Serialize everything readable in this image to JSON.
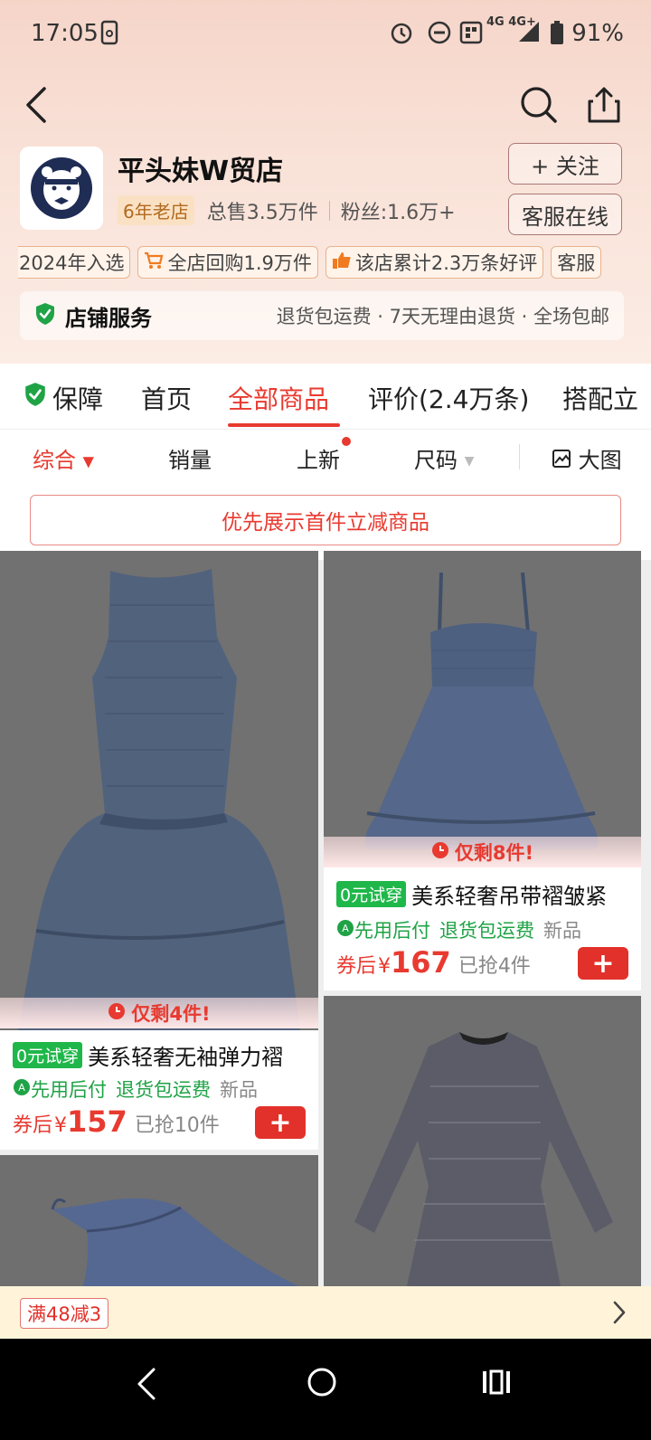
{
  "status_bar": {
    "time": "17:05",
    "network": "4G 4G+",
    "battery": "91%"
  },
  "shop": {
    "name": "平头妹W贸店",
    "years_badge": "6年老店",
    "total_sales": "总售3.5万件",
    "fans": "粉丝:1.6万+",
    "follow_label": "+ 关注",
    "service_label": "客服在线"
  },
  "tags": [
    {
      "text": "2024年入选",
      "icon": ""
    },
    {
      "text": "全店回购1.9万件",
      "icon": "cart-icon"
    },
    {
      "text": "该店累计2.3万条好评",
      "icon": "thumbs-up-icon"
    },
    {
      "text": "客服",
      "icon": ""
    }
  ],
  "shop_service": {
    "title": "店铺服务",
    "items": "退货包运费 · 7天无理由退货 · 全场包邮"
  },
  "tabs": [
    {
      "label": "保障",
      "icon": "shield-check-icon"
    },
    {
      "label": "首页"
    },
    {
      "label": "全部商品",
      "active": true
    },
    {
      "label": "评价(2.4万条)"
    },
    {
      "label": "搭配立"
    }
  ],
  "filters": {
    "comprehensive": "综合",
    "sales": "销量",
    "new": "上新",
    "size": "尺码",
    "large_view": "大图"
  },
  "promo_button": "优先展示首件立减商品",
  "products": [
    {
      "stock_note": "仅剩4件!",
      "trial_badge": "0元试穿",
      "title": "美系轻奢无袖弹力褶",
      "tag_pay_later": "先用后付",
      "tag_return": "退货包运费",
      "tag_new": "新品",
      "coupon_label": "券后",
      "currency": "¥",
      "price": "157",
      "sold": "已抢10件"
    },
    {
      "stock_note": "仅剩8件!",
      "trial_badge": "0元试穿",
      "title": "美系轻奢吊带褶皱紧",
      "tag_pay_later": "先用后付",
      "tag_return": "退货包运费",
      "tag_new": "新品",
      "coupon_label": "券后",
      "currency": "¥",
      "price": "167",
      "sold": "已抢4件"
    }
  ],
  "bottom_bar": {
    "coupon": "满48减3"
  },
  "colors": {
    "accent": "#e83a30",
    "green": "#1fa346",
    "header_bg": "#f6d5c9"
  }
}
